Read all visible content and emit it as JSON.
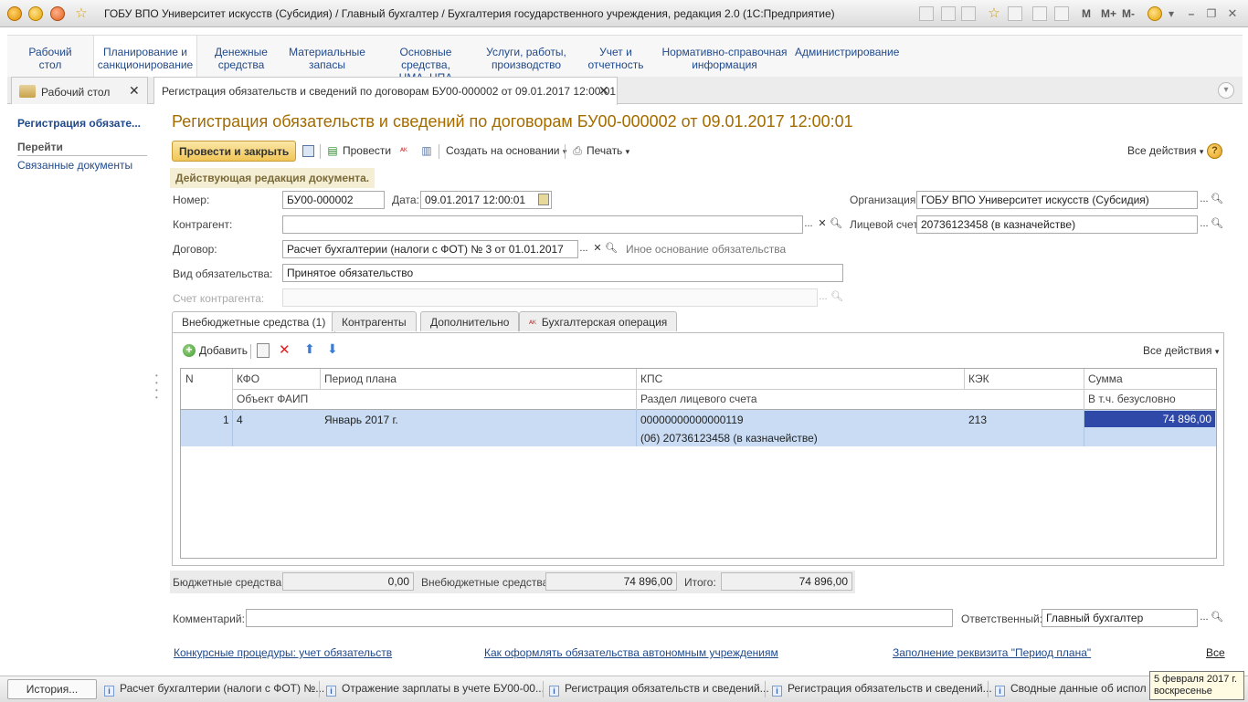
{
  "window": {
    "title": "ГОБУ ВПО Университет искусств (Субсидия) / Главный бухгалтер / Бухгалтерия государственного учреждения, редакция 2.0  (1С:Предприятие)"
  },
  "titlebar_buttons": {
    "m": "M",
    "mplus": "M+",
    "mminus": "M-"
  },
  "sections": [
    {
      "line1": "Рабочий",
      "line2": "стол"
    },
    {
      "line1": "Планирование и",
      "line2": "санкционирование"
    },
    {
      "line1": "Денежные",
      "line2": "средства"
    },
    {
      "line1": "Материальные",
      "line2": "запасы"
    },
    {
      "line1": "Основные средства,",
      "line2": "НМА, НПА"
    },
    {
      "line1": "Услуги, работы,",
      "line2": "производство"
    },
    {
      "line1": "Учет и",
      "line2": "отчетность"
    },
    {
      "line1": "Нормативно-справочная",
      "line2": "информация"
    },
    {
      "line1": "Администрирование",
      "line2": ""
    }
  ],
  "open_tabs": [
    {
      "label": "Рабочий стол"
    },
    {
      "label": "Регистрация обязательств и сведений по договорам БУ00-000002 от 09.01.2017 12:00:01"
    }
  ],
  "left_panel": {
    "title": "Регистрация обязате...",
    "goto": "Перейти",
    "link": "Связанные документы"
  },
  "document": {
    "title": "Регистрация обязательств и сведений по договорам БУ00-000002 от 09.01.2017 12:00:01",
    "toolbar": {
      "post_close": "Провести и закрыть",
      "post": "Провести",
      "create_based": "Создать на основании",
      "print": "Печать",
      "all_actions": "Все действия",
      "help": "?"
    },
    "note": "Действующая редакция документа.",
    "fields": {
      "number_label": "Номер:",
      "number": "БУ00-000002",
      "date_label": "Дата:",
      "date": "09.01.2017 12:00:01",
      "org_label": "Организация:",
      "org": "ГОБУ ВПО Университет искусств (Субсидия)",
      "contractor_label": "Контрагент:",
      "contractor": "",
      "account_label": "Лицевой счет:",
      "account": "20736123458 (в казначействе)",
      "contract_label": "Договор:",
      "contract": "Расчет бухгалтерии (налоги с ФОТ) № 3 от 01.01.2017",
      "other_basis": "Иное основание обязательства",
      "kind_label": "Вид обязательства:",
      "kind": "Принятое обязательство",
      "contractor_account_label": "Счет контрагента:",
      "contractor_account": ""
    },
    "tabs": [
      {
        "label": "Внебюджетные средства (1)"
      },
      {
        "label": "Контрагенты"
      },
      {
        "label": "Дополнительно"
      },
      {
        "label": "Бухгалтерская операция"
      }
    ],
    "table_toolbar": {
      "add": "Добавить",
      "all_actions": "Все действия"
    },
    "table": {
      "headers_row1": [
        "N",
        "КФО",
        "Период плана",
        "КПС",
        "КЭК",
        "Сумма"
      ],
      "headers_row2": [
        "Объект ФАИП",
        "Раздел лицевого счета",
        "В т.ч. безусловно"
      ],
      "rows": [
        {
          "n": "1",
          "kfo": "4",
          "period": "Январь 2017 г.",
          "kps": "00000000000000119",
          "kek": "213",
          "sum": "74 896,00",
          "faip": "",
          "section": "(06) 20736123458 (в казначействе)",
          "unconditional": ""
        }
      ]
    },
    "totals": {
      "budget_label": "Бюджетные средства:",
      "budget": "0,00",
      "extrabudget_label": "Внебюджетные средства:",
      "extrabudget": "74 896,00",
      "total_label": "Итого:",
      "total": "74 896,00"
    },
    "comment_label": "Комментарий:",
    "comment": "",
    "responsible_label": "Ответственный:",
    "responsible": "Главный бухгалтер",
    "links": [
      "Конкурсные процедуры: учет обязательств",
      "Как оформлять обязательства автономным учреждениям",
      "Заполнение реквизита \"Период плана\"",
      "Все"
    ]
  },
  "taskbar": {
    "history": "История...",
    "items": [
      "Расчет бухгалтерии (налоги с ФОТ) №...",
      "Отражение зарплаты в учете БУ00-00...",
      "Регистрация обязательств и сведений...",
      "Регистрация обязательств и сведений...",
      "Сводные данные об исполнен"
    ],
    "tooltip_line1": "5 февраля 2017 г.",
    "tooltip_line2": "воскресенье"
  },
  "colors": {
    "accent_title": "#a36b00",
    "link": "#214a8c",
    "selected_row": "#c9dcf3",
    "active_cell": "#2e49a8",
    "primary_button": "#f1c657"
  }
}
